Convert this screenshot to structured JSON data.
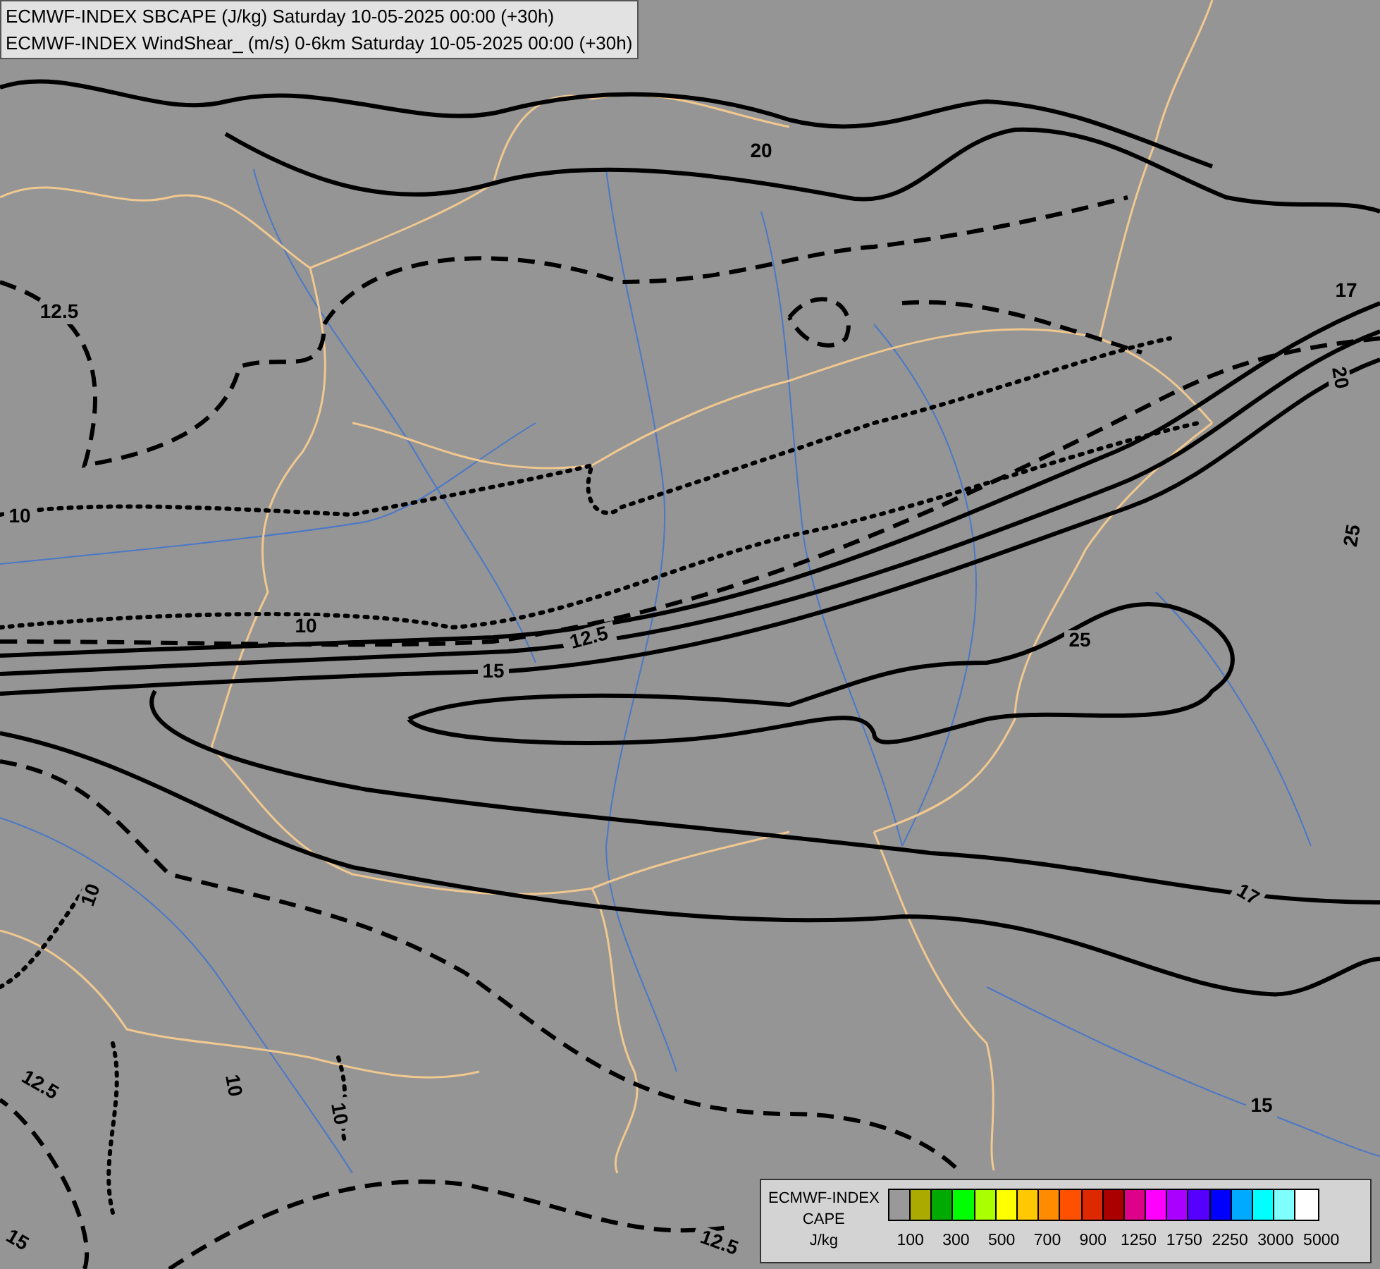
{
  "header": {
    "lines": [
      "ECMWF-INDEX SBCAPE (J/kg) Saturday 10-05-2025 00:00 (+30h)",
      "ECMWF-INDEX WindShear_ (m/s) 0-6km Saturday 10-05-2025 00:00 (+30h)"
    ]
  },
  "contour_labels": [
    {
      "text": "20"
    },
    {
      "text": "17"
    },
    {
      "text": "12.5"
    },
    {
      "text": "20"
    },
    {
      "text": "10"
    },
    {
      "text": "25"
    },
    {
      "text": "10"
    },
    {
      "text": "12.5"
    },
    {
      "text": "25"
    },
    {
      "text": "15"
    },
    {
      "text": "17"
    },
    {
      "text": "10"
    },
    {
      "text": "12.5"
    },
    {
      "text": "10"
    },
    {
      "text": "10"
    },
    {
      "text": "15"
    },
    {
      "text": "12.5"
    },
    {
      "text": "15"
    }
  ],
  "legend": {
    "title_lines": [
      "ECMWF-INDEX",
      "CAPE",
      "J/kg"
    ],
    "swatches": [
      {
        "color": "#999999"
      },
      {
        "color": "#aaaa00"
      },
      {
        "color": "#00aa00"
      },
      {
        "color": "#00ff00"
      },
      {
        "color": "#aaff00"
      },
      {
        "color": "#ffff00"
      },
      {
        "color": "#ffc800"
      },
      {
        "color": "#ff8c00"
      },
      {
        "color": "#ff5000"
      },
      {
        "color": "#dd2800"
      },
      {
        "color": "#aa0000"
      },
      {
        "color": "#dd0088"
      },
      {
        "color": "#ff00ff"
      },
      {
        "color": "#aa00ff"
      },
      {
        "color": "#5500ff"
      },
      {
        "color": "#0000ff"
      },
      {
        "color": "#00aaff"
      },
      {
        "color": "#00ffff"
      },
      {
        "color": "#80ffff"
      },
      {
        "color": "#ffffff"
      }
    ],
    "tick_labels": [
      "100",
      "300",
      "500",
      "700",
      "900",
      "1250",
      "1750",
      "2250",
      "3000",
      "5000"
    ]
  }
}
